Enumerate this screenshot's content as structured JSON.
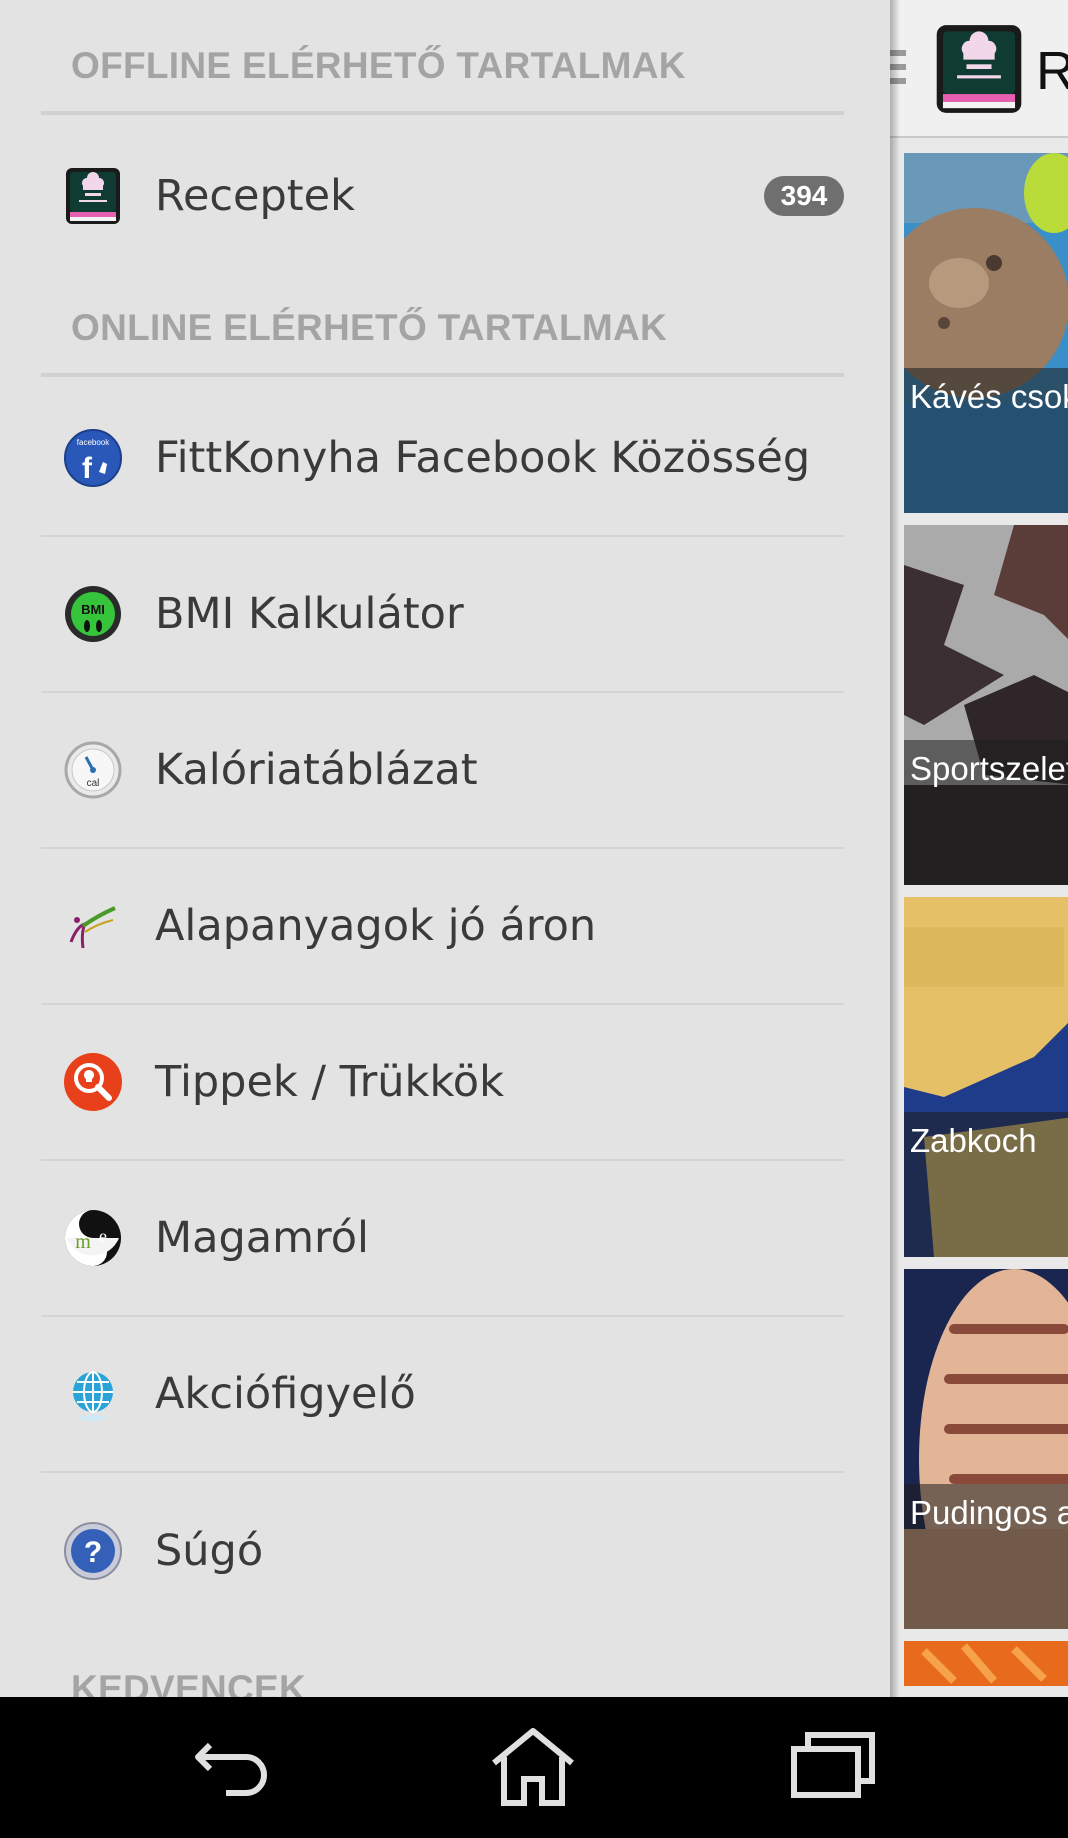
{
  "drawer": {
    "offline_header": "OFFLINE ELÉRHETŐ TARTALMAK",
    "online_header": "ONLINE ELÉRHETŐ TARTALMAK",
    "favorites_header": "KEDVENCEK",
    "offline_items": [
      {
        "label": "Receptek",
        "badge": "394",
        "icon": "cookbook-icon"
      }
    ],
    "online_items": [
      {
        "label": "FittKonyha Facebook Közösség",
        "icon": "facebook-icon"
      },
      {
        "label": "BMI Kalkulátor",
        "icon": "bmi-icon"
      },
      {
        "label": "Kalóriatáblázat",
        "icon": "calorie-gauge-icon"
      },
      {
        "label": "Alapanyagok jó áron",
        "icon": "shop-logo-icon"
      },
      {
        "label": "Tippek / Trükkök",
        "icon": "magnifier-bulb-icon"
      },
      {
        "label": "Magamról",
        "icon": "yin-yang-me-icon"
      },
      {
        "label": "Akciófigyelő",
        "icon": "globe-icon"
      },
      {
        "label": "Súgó",
        "icon": "help-icon"
      }
    ]
  },
  "content": {
    "title": "Receptek",
    "cards": [
      {
        "caption": "Kávés csok"
      },
      {
        "caption": "Sportszelet"
      },
      {
        "caption": "Zabkoch"
      },
      {
        "caption": "Pudingos a"
      }
    ]
  },
  "navbar": {
    "buttons": [
      "back",
      "home",
      "recents"
    ]
  },
  "colors": {
    "drawer_bg": "#e3e3e3",
    "header_text": "#a4a4a4",
    "item_text": "#3a3a3a",
    "badge_bg": "#6f6f6f",
    "navbar_bg": "#000000"
  }
}
